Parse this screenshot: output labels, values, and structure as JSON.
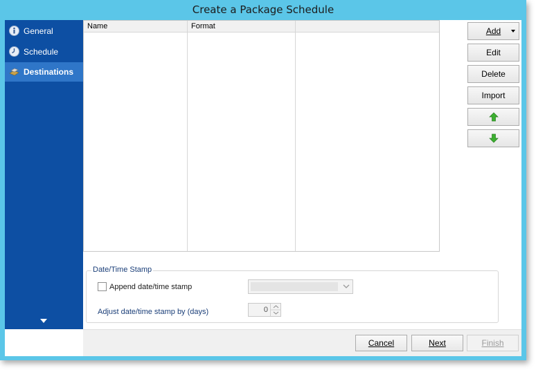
{
  "window": {
    "title": "Create a Package Schedule"
  },
  "sidebar": {
    "items": [
      {
        "label": "General",
        "icon": "info-icon",
        "active": false
      },
      {
        "label": "Schedule",
        "icon": "clock-icon",
        "active": false
      },
      {
        "label": "Destinations",
        "icon": "destinations-icon",
        "active": true
      }
    ],
    "more_icon": "chevron-down-icon"
  },
  "destinations_list": {
    "columns": [
      "Name",
      "Format",
      ""
    ],
    "rows": []
  },
  "side_buttons": {
    "add": "Add",
    "edit": "Edit",
    "delete": "Delete",
    "import": "Import",
    "move_up_icon": "arrow-up-icon",
    "move_down_icon": "arrow-down-icon"
  },
  "datetime_stamp": {
    "group_title": "Date/Time Stamp",
    "append_label": "Append date/time stamp",
    "append_checked": false,
    "format_value": "",
    "adjust_label": "Adjust date/time stamp by (days)",
    "adjust_value": "0"
  },
  "footer": {
    "cancel": "Cancel",
    "next": "Next",
    "finish": "Finish"
  },
  "colors": {
    "title_bar": "#5bc6e8",
    "sidebar": "#0d4fa3",
    "sidebar_active": "#2f76c8",
    "up_arrow": "#3cb030",
    "down_arrow": "#3cb030"
  }
}
